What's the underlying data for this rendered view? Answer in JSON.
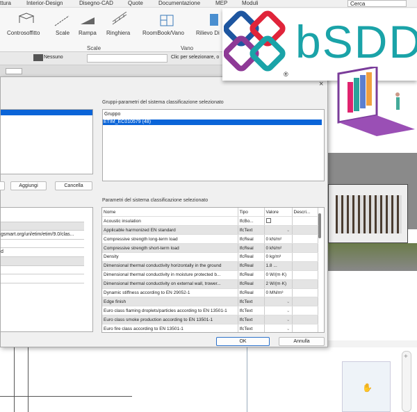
{
  "menubar": {
    "items": [
      "ttura",
      "Interior-Design",
      "Disegno-CAD",
      "Quote",
      "Documentazione",
      "MEP",
      "Moduli"
    ],
    "search_placeholder": "Cerca"
  },
  "ribbon": {
    "buttons": [
      "Controsoffitto",
      "Scale",
      "Rampa",
      "Ringhiera",
      "RoomBook/Vano",
      "Rilievo Di"
    ],
    "groups": [
      "Scale",
      "Vano"
    ]
  },
  "toolbar": {
    "layer": "Nessuno",
    "hint": "Clic per selezionare, o"
  },
  "logo": {
    "text": "bSDD",
    "reg": "®"
  },
  "dialog": {
    "left_buttons": [
      "Aggiungi",
      "Cancella"
    ],
    "left_props": [
      "",
      "",
      "gsmart.org/uri/etim/etim/9.0/clas...",
      "",
      "d",
      "",
      "",
      ""
    ],
    "groups_label": "Gruppi-parametri del sistema classificazione selezionato",
    "groups_header": "Gruppo",
    "groups_selected": "ETIM_EC010579 (48)",
    "params_label": "Parametri del sistema classificazione selezionato",
    "columns": [
      "Nome",
      "Tipo",
      "Valore",
      "Descri..."
    ],
    "rows": [
      {
        "name": "Acoustic insulation",
        "type": "IfcBo...",
        "value": "",
        "ctrl": "checkbox"
      },
      {
        "name": "Applicable harmonized EN standard",
        "type": "IfcText",
        "value": "",
        "ctrl": "dropdown"
      },
      {
        "name": "Compressive strength long-term load",
        "type": "IfcReal",
        "value": "0 kN/m²",
        "ctrl": ""
      },
      {
        "name": "Compressive strength short-term load",
        "type": "IfcReal",
        "value": "0 kN/m²",
        "ctrl": ""
      },
      {
        "name": "Density",
        "type": "IfcReal",
        "value": "0 kg/m³",
        "ctrl": ""
      },
      {
        "name": "Dimensional thermal conductivity horizontally in the ground",
        "type": "IfcReal",
        "value": "1.8 ...",
        "ctrl": ""
      },
      {
        "name": "Dimensional thermal conductivity in moisture protected b...",
        "type": "IfcReal",
        "value": "0 W/(m·K)",
        "ctrl": ""
      },
      {
        "name": "Dimensional thermal conductivity on external wall, trower...",
        "type": "IfcReal",
        "value": "2 W/(m·K)",
        "ctrl": ""
      },
      {
        "name": "Dynamic stiffness according to EN 29052-1",
        "type": "IfcReal",
        "value": "0 MN/m³",
        "ctrl": ""
      },
      {
        "name": "Edge finish",
        "type": "IfcText",
        "value": "",
        "ctrl": "dropdown"
      },
      {
        "name": "Euro class flaming droplets/particles according to EN 13501-1",
        "type": "IfcText",
        "value": "",
        "ctrl": "dropdown"
      },
      {
        "name": "Euro class smoke production according to EN 13501-1",
        "type": "IfcText",
        "value": "",
        "ctrl": "dropdown"
      },
      {
        "name": "Euro fire class according to EN 13501-1",
        "type": "IfcText",
        "value": "",
        "ctrl": "dropdown"
      }
    ],
    "ok": "OK",
    "cancel": "Annulla",
    "close": "×"
  },
  "colors": {
    "selection": "#0a64d8",
    "logo_text": "#1aa3a8"
  }
}
